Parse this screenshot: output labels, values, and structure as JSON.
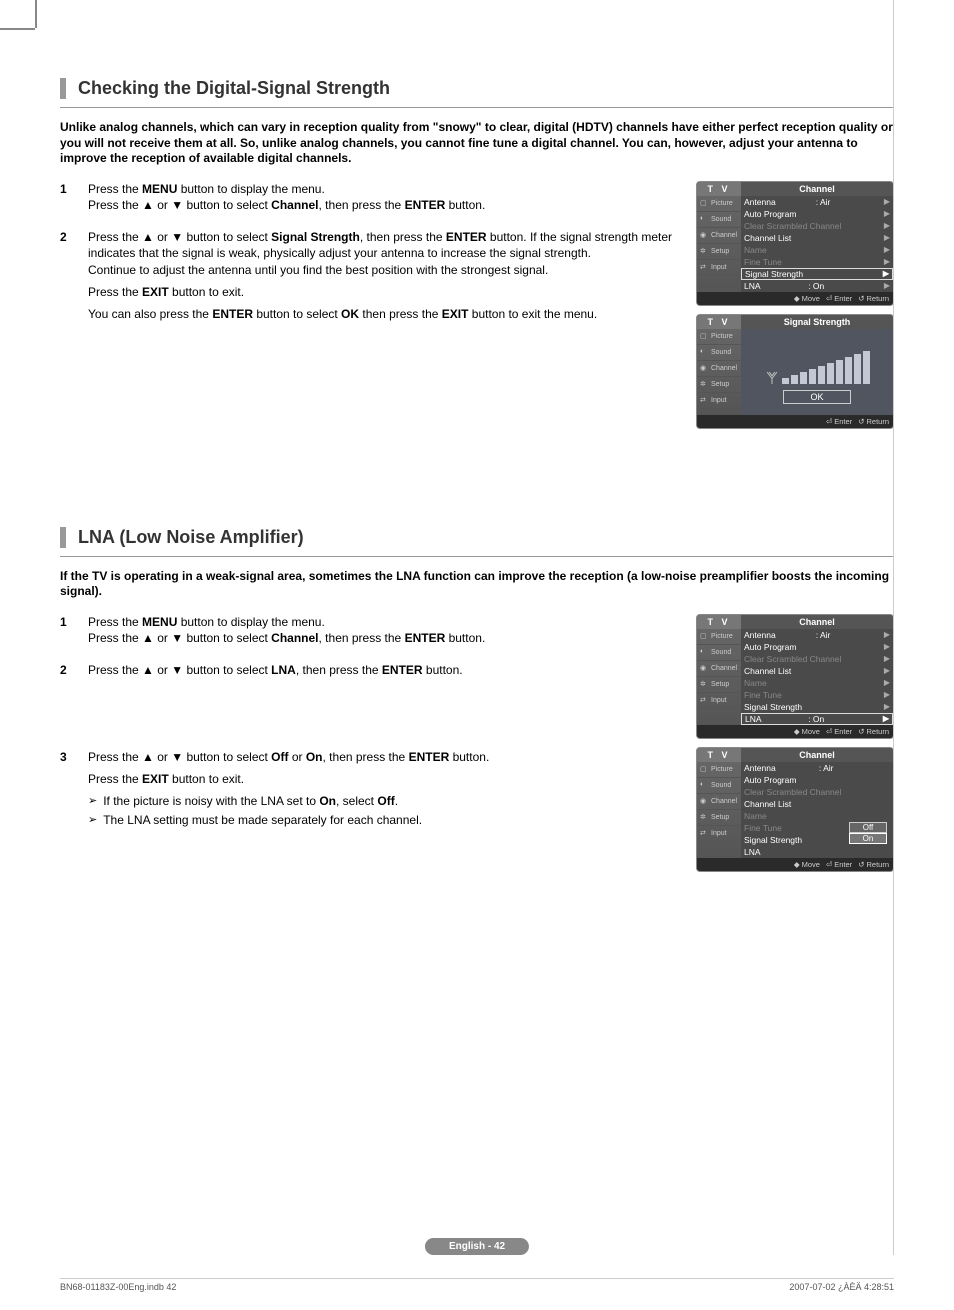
{
  "section1": {
    "title": "Checking the Digital-Signal Strength",
    "intro": "Unlike analog channels, which can vary in reception quality from \"snowy\" to clear, digital (HDTV) channels have either perfect reception quality or you will not receive them at all. So, unlike analog channels, you cannot fine tune a digital channel. You can, however, adjust your antenna to improve the reception of available digital channels.",
    "step1_num": "1",
    "step1_l1a": "Press the ",
    "step1_l1b": "MENU",
    "step1_l1c": " button to display the menu.",
    "step1_l2a": "Press the ▲ or ▼ button to select ",
    "step1_l2b": "Channel",
    "step1_l2c": ", then press the ",
    "step1_l2d": "ENTER",
    "step1_l2e": " button.",
    "step2_num": "2",
    "step2_l1a": "Press the ▲ or ▼ button to select ",
    "step2_l1b": "Signal Strength",
    "step2_l1c": ", then press the ",
    "step2_l1d": "ENTER",
    "step2_l1e": " button. If the signal strength meter indicates that the signal is weak, physically adjust your antenna to increase the signal strength.",
    "step2_l2": "Continue to adjust the antenna until you find the best position with the strongest signal.",
    "step2_l3a": "Press the ",
    "step2_l3b": "EXIT",
    "step2_l3c": " button to exit.",
    "step2_l4a": "You can also press the ",
    "step2_l4b": "ENTER",
    "step2_l4c": " button to select ",
    "step2_l4d": "OK",
    "step2_l4e": " then press the ",
    "step2_l4f": "EXIT",
    "step2_l4g": " button to exit the menu."
  },
  "section2": {
    "title": "LNA (Low Noise Amplifier)",
    "intro": "If the TV is operating in a weak-signal area, sometimes the LNA function can improve the reception (a low-noise preamplifier boosts the incoming signal).",
    "step1_num": "1",
    "step1_l1a": "Press the ",
    "step1_l1b": "MENU",
    "step1_l1c": " button to display the menu.",
    "step1_l2a": "Press the ▲ or ▼ button to select ",
    "step1_l2b": "Channel",
    "step1_l2c": ", then press the ",
    "step1_l2d": "ENTER",
    "step1_l2e": " button.",
    "step2_num": "2",
    "step2_l1a": "Press the ▲ or ▼ button to select ",
    "step2_l1b": "LNA",
    "step2_l1c": ", then press the ",
    "step2_l1d": "ENTER",
    "step2_l1e": " button.",
    "step3_num": "3",
    "step3_l1a": "Press the ▲ or ▼ button to select ",
    "step3_l1b": "Off",
    "step3_l1c": " or ",
    "step3_l1d": "On",
    "step3_l1e": ", then press the ",
    "step3_l1f": "ENTER",
    "step3_l1g": " button.",
    "step3_l2a": "Press the ",
    "step3_l2b": "EXIT",
    "step3_l2c": " button to exit.",
    "note1a": "If the picture is noisy with the LNA set to ",
    "note1b": "On",
    "note1c": ", select ",
    "note1d": "Off",
    "note1e": ".",
    "note2": "The LNA setting must be made separately for each channel."
  },
  "tv": {
    "label": "T V",
    "channel_title": "Channel",
    "signal_title": "Signal Strength",
    "side_picture": "Picture",
    "side_sound": "Sound",
    "side_channel": "Channel",
    "side_setup": "Setup",
    "side_input": "Input",
    "antenna": "Antenna",
    "antenna_val": ": Air",
    "auto_program": "Auto Program",
    "clear_scrambled": "Clear Scrambled Channel",
    "channel_list": "Channel List",
    "name": "Name",
    "fine_tune": "Fine Tune",
    "signal_strength": "Signal Strength",
    "lna": "LNA",
    "lna_val": ": On",
    "off": "Off",
    "on": "On",
    "ok": "OK",
    "move": "Move",
    "enter": "Enter",
    "return": "Return"
  },
  "footer": {
    "page": "English - 42",
    "file": "BN68-01183Z-00Eng.indb   42",
    "date": "2007-07-02   ¿ÀÈÄ 4:28:51"
  },
  "arrow": "➢"
}
